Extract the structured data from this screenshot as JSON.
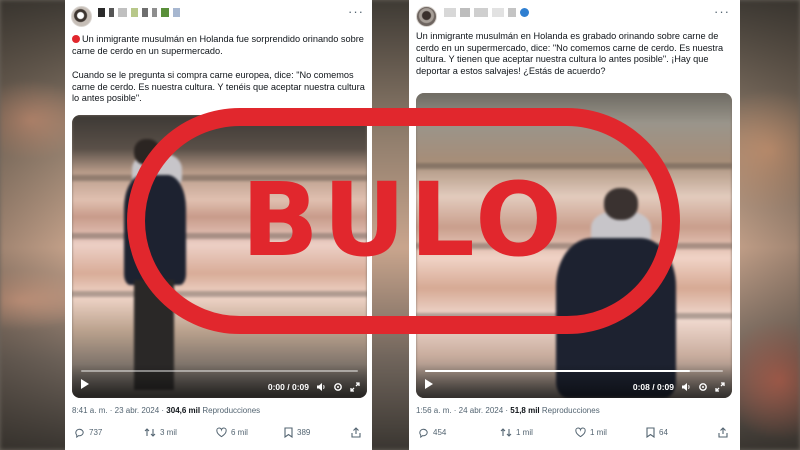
{
  "left_tweet": {
    "text_p1": "Un inmigrante musulmán en Holanda fue sorprendido orinando sobre carne de cerdo en un supermercado.",
    "text_p2": "Cuando se le pregunta si compra carne europea, dice: \"No comemos carne de cerdo. Es nuestra cultura. Y tenéis que aceptar nuestra cultura lo antes posible\".",
    "video": {
      "time": "0:00 / 0:09",
      "progress": 0.0
    },
    "timestamp": "8:41 a. m. · 23 abr. 2024 ·",
    "views": "304,6 mil",
    "views_label": "Reproducciones",
    "replies": "737",
    "reposts": "3 mil",
    "likes": "6 mil",
    "bookmarks": "389"
  },
  "right_tweet": {
    "text": "Un inmigrante musulmán en Holanda es grabado orinando sobre carne de cerdo en un supermercado, dice: \"No comemos carne de cerdo. Es nuestra cultura. Y tienen que aceptar nuestra cultura lo antes posible\". ¡Hay que deportar a estos salvajes! ¿Estás de acuerdo?",
    "video": {
      "time": "0:08 / 0:09",
      "progress": 0.89
    },
    "timestamp": "1:56 a. m. · 24 abr. 2024 ·",
    "views": "51,8 mil",
    "views_label": "Reproducciones",
    "replies": "454",
    "reposts": "1 mil",
    "likes": "1 mil",
    "bookmarks": "64"
  },
  "stamp": {
    "label": "BULO",
    "color": "#e1272d"
  },
  "colors": {
    "accent_red": "#e1272d",
    "muted_text": "#536471",
    "text": "#0f1419"
  },
  "icons": [
    "more-icon",
    "play-icon",
    "settings-icon",
    "fullscreen-icon",
    "volume-icon",
    "reply-icon",
    "repost-icon",
    "like-icon",
    "bookmark-icon",
    "share-icon"
  ]
}
